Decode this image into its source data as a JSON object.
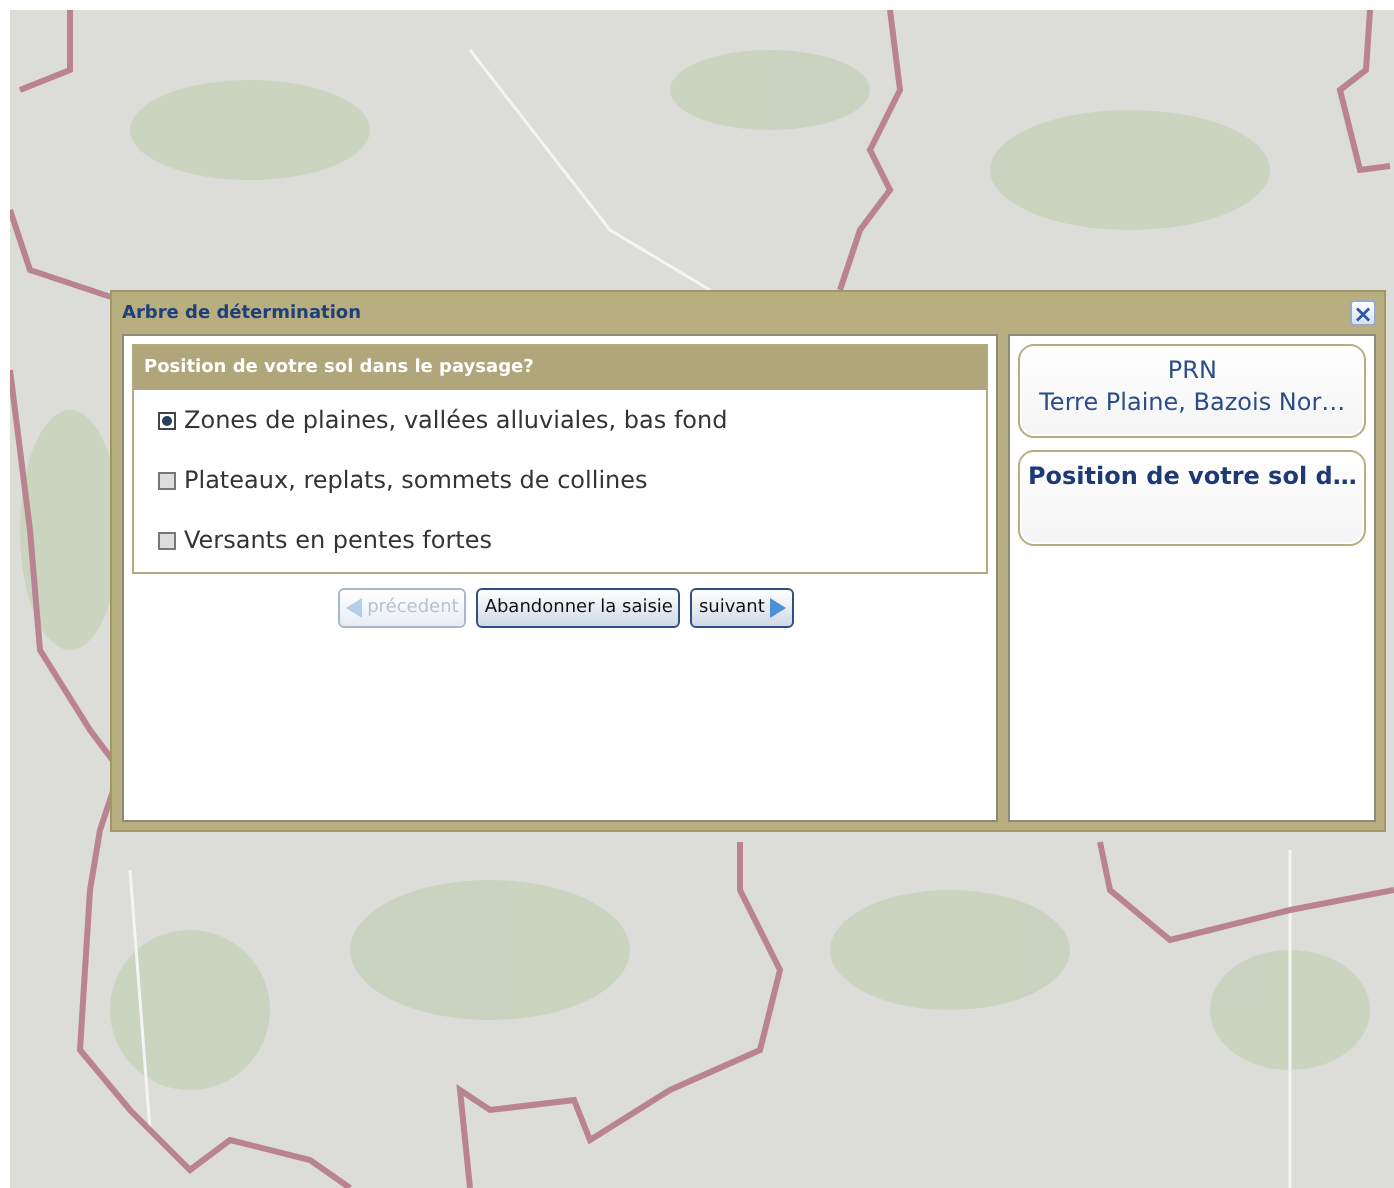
{
  "dialog": {
    "title": "Arbre de détermination",
    "close": "×"
  },
  "question": {
    "title": "Position de votre sol dans le paysage?",
    "options": [
      {
        "label": "Zones de plaines, vallées alluviales, bas fond",
        "selected": true
      },
      {
        "label": "Plateaux, replats, sommets de collines",
        "selected": false
      },
      {
        "label": "Versants en pentes fortes",
        "selected": false
      }
    ]
  },
  "buttons": [
    {
      "kind": "back",
      "label": "précedent",
      "disabled": true
    },
    {
      "kind": "plain",
      "label": "Abandonner la saisie",
      "disabled": false
    },
    {
      "kind": "next",
      "label": "suivant",
      "disabled": false
    }
  ],
  "history": [
    {
      "kind": "result",
      "lines": [
        "PRN",
        "Terre Plaine, Bazois Nor…"
      ]
    },
    {
      "kind": "step",
      "lines": [
        "Position de votre sol d…"
      ]
    }
  ]
}
